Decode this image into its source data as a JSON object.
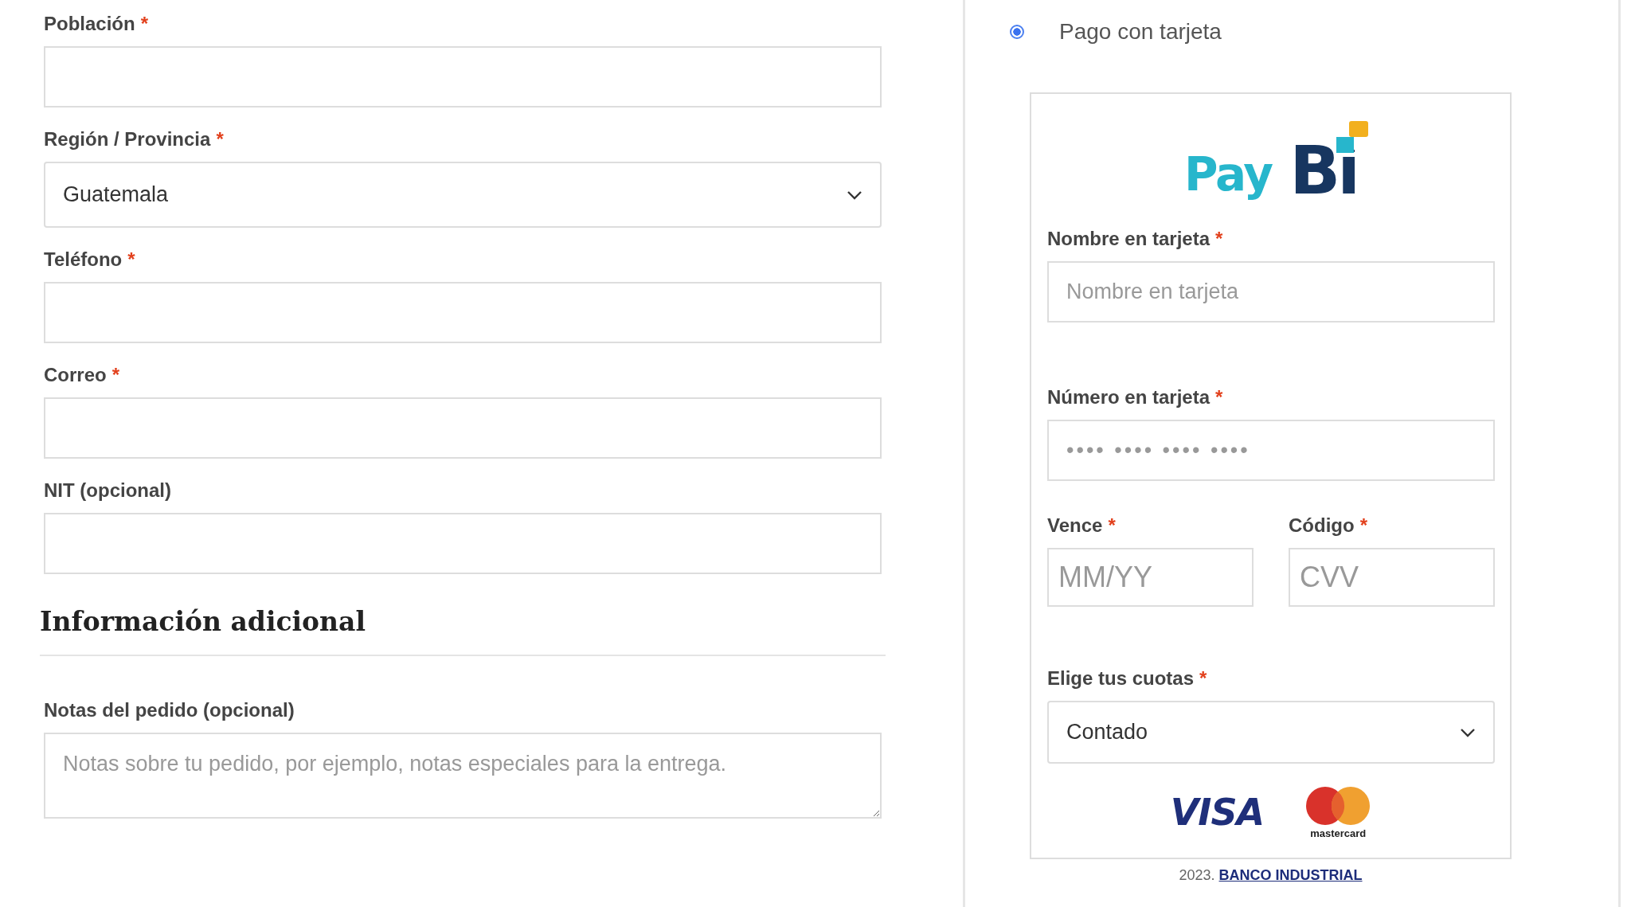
{
  "billing_fields": [
    {
      "kind": "text",
      "label": "Población",
      "required_mark": "*"
    },
    {
      "kind": "select",
      "label": "Región / Provincia",
      "required_mark": "*",
      "value": "Guatemala"
    },
    {
      "kind": "text",
      "label": "Teléfono",
      "required_mark": "*"
    },
    {
      "kind": "text",
      "label": "Correo",
      "required_mark": "*"
    },
    {
      "kind": "text",
      "label": "NIT (opcional)"
    }
  ],
  "additional": {
    "heading": "Información adicional",
    "fields": [
      {
        "kind": "textarea",
        "label": "Notas del pedido (opcional)",
        "placeholder": "Notas sobre tu pedido, por ejemplo, notas especiales para la entrega."
      }
    ]
  },
  "payment": {
    "option": {
      "label": "Pago con tarjeta",
      "selected": true
    },
    "logo": {
      "text_1": "Pay",
      "text_2": "Bi"
    },
    "name_field": {
      "label": "Nombre en tarjeta",
      "required_mark": "*",
      "placeholder": "Nombre en tarjeta"
    },
    "number_field": {
      "label": "Número en tarjeta",
      "required_mark": "*",
      "placeholder": "•••• •••• •••• ••••"
    },
    "expiry_field": {
      "label": "Vence",
      "required_mark": "*",
      "placeholder": "MM/YY"
    },
    "cvv_field": {
      "label": "Código",
      "required_mark": "*",
      "placeholder": "CVV"
    },
    "installments": {
      "label": "Elige tus cuotas",
      "required_mark": "*",
      "value": "Contado"
    },
    "card_brands": {
      "visa": "VISA",
      "mastercard": "mastercard"
    },
    "footer": {
      "year": "2023.",
      "link": "BANCO INDUSTRIAL"
    }
  }
}
